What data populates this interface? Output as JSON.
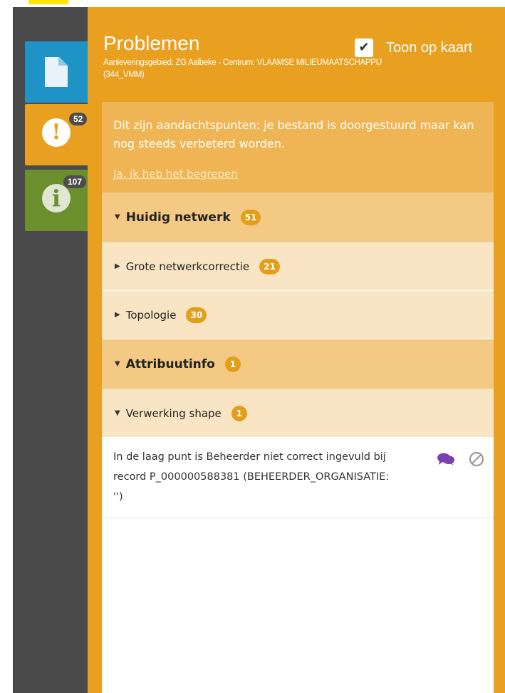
{
  "sidebar": {
    "tabs": [
      {
        "name": "documents",
        "icon": "file-icon",
        "color": "#1e93c6"
      },
      {
        "name": "problems",
        "icon": "exclamation-icon",
        "count": "52",
        "color": "#e9a020"
      },
      {
        "name": "info",
        "icon": "info-icon",
        "count": "107",
        "color": "#6a8f2c"
      }
    ]
  },
  "panel": {
    "title": "Problemen",
    "subtitle": "Aanleveringsgebied: ZG Aalbeke - Centrum: VLAAMSE MILIEUMAATSCHAPPIJ (344_VMM)",
    "show_on_map_label": "Toon op kaart",
    "show_on_map_checked": true,
    "notice": {
      "text": "Dit zijn aandachtspunten: je bestand is doorgestuurd maar kan nog steeds verbeterd worden.",
      "link": "Ja, ik heb het begrepen"
    },
    "groups": [
      {
        "label": "Huidig netwerk",
        "count": "51",
        "expanded": true,
        "children": [
          {
            "label": "Grote netwerkcorrectie",
            "count": "21",
            "expanded": false
          },
          {
            "label": "Topologie",
            "count": "30",
            "expanded": false
          }
        ]
      },
      {
        "label": "Attribuutinfo",
        "count": "1",
        "expanded": true,
        "children": [
          {
            "label": "Verwerking shape",
            "count": "1",
            "expanded": true
          }
        ]
      }
    ],
    "problem": {
      "text": "In de laag punt is Beheerder niet correct ingevuld bij record P_000000588381 (BEHEERDER_ORGANISATIE: '')"
    }
  },
  "colors": {
    "accent": "#e9a020",
    "comment_icon": "#7a3fb0"
  }
}
